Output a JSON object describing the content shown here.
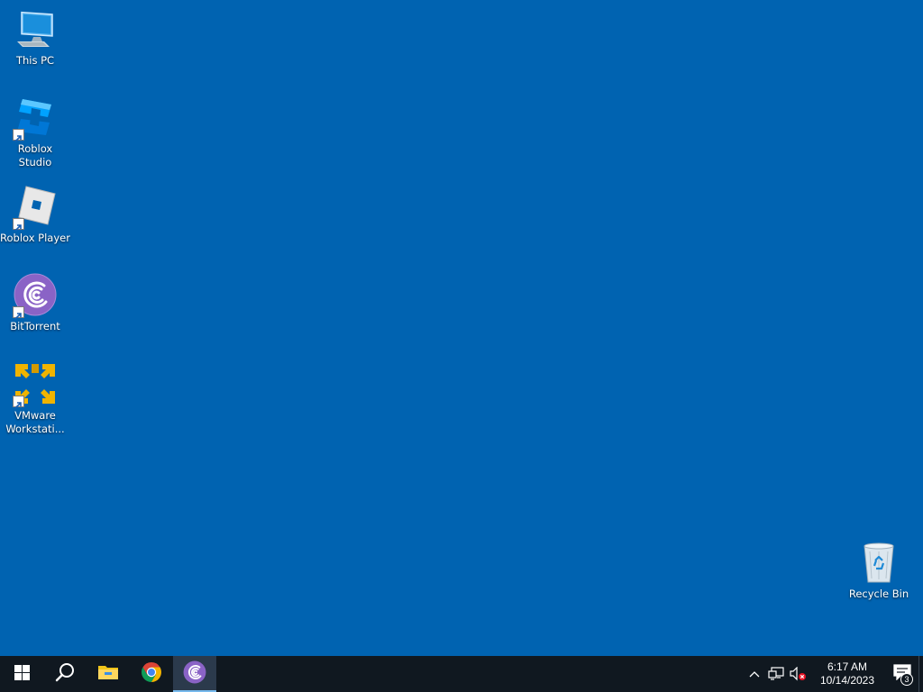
{
  "desktop": {
    "background_color": "#0063b1",
    "icons": [
      {
        "label": "This PC",
        "icon": "monitor-icon",
        "shortcut": false
      },
      {
        "label": "Roblox Studio",
        "icon": "roblox-studio-icon",
        "shortcut": true
      },
      {
        "label": "Roblox Player",
        "icon": "roblox-player-icon",
        "shortcut": true
      },
      {
        "label": "BitTorrent",
        "icon": "bittorrent-icon",
        "shortcut": true
      },
      {
        "label": "VMware Workstati...",
        "icon": "vmware-icon",
        "shortcut": true
      },
      {
        "label": "Recycle Bin",
        "icon": "recycle-bin-icon",
        "shortcut": false
      }
    ]
  },
  "taskbar": {
    "background_color": "#101820",
    "pinned": [
      {
        "name": "Start",
        "icon": "windows-logo-icon"
      },
      {
        "name": "Search",
        "icon": "search-icon"
      },
      {
        "name": "File Explorer",
        "icon": "folder-icon"
      },
      {
        "name": "Google Chrome",
        "icon": "chrome-icon"
      },
      {
        "name": "BitTorrent",
        "icon": "bittorrent-icon",
        "active": true
      }
    ],
    "tray": {
      "icons": [
        "chevron-up-icon",
        "network-icon",
        "volume-muted-icon"
      ],
      "time": "6:17 AM",
      "date": "10/14/2023",
      "notification_count": "3"
    }
  }
}
